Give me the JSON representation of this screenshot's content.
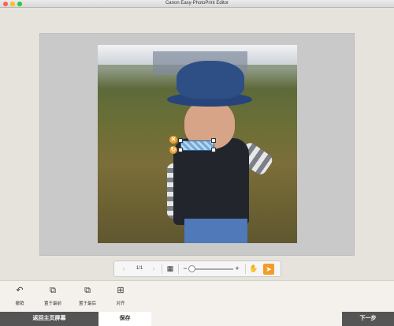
{
  "window": {
    "title": "Canon Easy-PhotoPrint Editor"
  },
  "nav": {
    "prev_icon": "‹",
    "page_indicator": "1/1",
    "next_icon": "›",
    "grid_icon": "▦",
    "zoom_out_icon": "−",
    "zoom_in_icon": "+",
    "hand_icon": "✋",
    "pointer_icon": "➤"
  },
  "stamp": {
    "delete_icon": "✕",
    "rotate_icon": "↻"
  },
  "toolbar": {
    "tools": [
      {
        "label": "撤销",
        "icon": "↶"
      },
      {
        "label": "置于最前",
        "icon": "⧉"
      },
      {
        "label": "置于最后",
        "icon": "⧉"
      },
      {
        "label": "对齐",
        "icon": "⊞"
      }
    ]
  },
  "bottom": {
    "back_label": "返回主页屏幕",
    "save_label": "保存",
    "next_label": "下一步"
  },
  "colors": {
    "accent": "#f39c2b",
    "dark_button": "#555555"
  }
}
